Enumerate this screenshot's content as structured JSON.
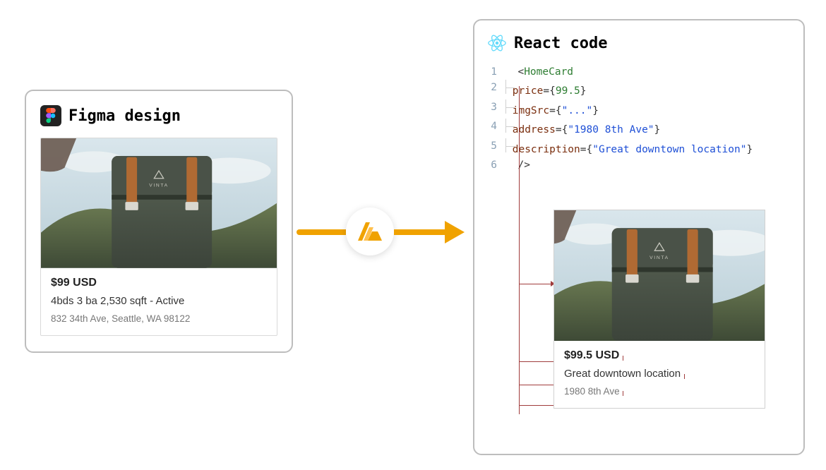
{
  "figma": {
    "title": "Figma design",
    "card": {
      "price": "$99 USD",
      "desc": "4bds 3 ba 2,530 sqft - Active",
      "addr": "832 34th Ave, Seattle, WA 98122"
    }
  },
  "react": {
    "title": "React code",
    "code": {
      "lines": [
        "1",
        "2",
        "3",
        "4",
        "5",
        "6"
      ],
      "component": "HomeCard",
      "props": {
        "price_attr": "price",
        "price_val": "99.5",
        "imgSrc_attr": "imgSrc",
        "imgSrc_val": "\"...\"",
        "address_attr": "address",
        "address_val": "\"1980 8th Ave\"",
        "description_attr": "description",
        "description_val": "\"Great downtown location\""
      }
    },
    "output": {
      "price": "$99.5 USD",
      "desc": "Great downtown location",
      "addr": "1980 8th Ave"
    }
  },
  "colors": {
    "arrow": "#f0a200",
    "connector": "#a03c3c",
    "react": "#61dafb"
  }
}
